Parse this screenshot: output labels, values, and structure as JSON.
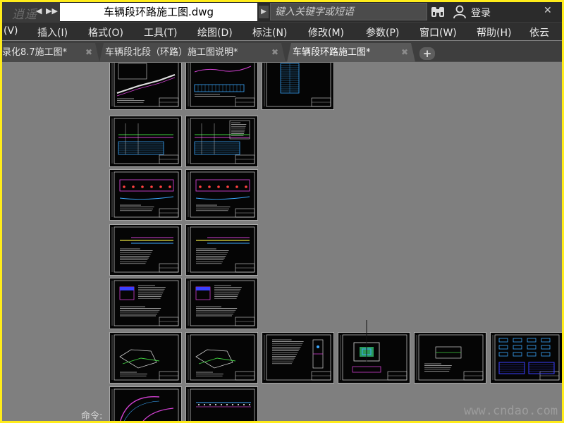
{
  "app": {
    "logo_text": "逍遥",
    "qat_back": "◀",
    "qat_forward": "▶▶"
  },
  "titlebar": {
    "document_title": "车辆段环路施工图.dwg",
    "search_arrow": "▶",
    "search_placeholder": "键入关键字或短语",
    "login_label": "登录",
    "close_glyph": "✕"
  },
  "menu": {
    "items": [
      "(V)",
      "插入(I)",
      "格式(O)",
      "工具(T)",
      "绘图(D)",
      "标注(N)",
      "修改(M)",
      "参数(P)",
      "窗口(W)",
      "帮助(H)",
      "依云"
    ]
  },
  "tabs": {
    "items": [
      {
        "label": "录化8.7施工图*",
        "active": false
      },
      {
        "label": "车辆段北段（环路）施工图说明*",
        "active": false
      },
      {
        "label": "车辆段环路施工图*",
        "active": true
      }
    ],
    "close_glyph": "✖",
    "add_glyph": "+"
  },
  "canvas": {
    "command_label": "命令:",
    "watermark": "www.cndao.com"
  },
  "colors": {
    "canvas_bg": "#7f7f7f",
    "sheet_bg": "#050505",
    "frame_border": "#ffec1a"
  }
}
